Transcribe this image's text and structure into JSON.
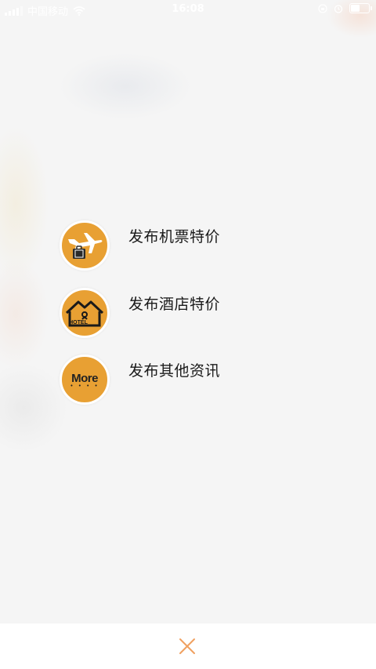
{
  "status_bar": {
    "carrier": "中国移动",
    "time": "16:08"
  },
  "menu": {
    "items": [
      {
        "label": "发布机票特价",
        "icon": "airplane-luggage-icon"
      },
      {
        "label": "发布酒店特价",
        "icon": "hotel-house-icon"
      },
      {
        "label": "发布其他资讯",
        "icon": "more-icon"
      }
    ],
    "hotel_icon_text": "HOTEL",
    "more_icon_text": "More"
  },
  "bottom_bar": {
    "close_icon": "close-icon"
  },
  "colors": {
    "accent": "#e8a033",
    "close": "#f0a060"
  }
}
